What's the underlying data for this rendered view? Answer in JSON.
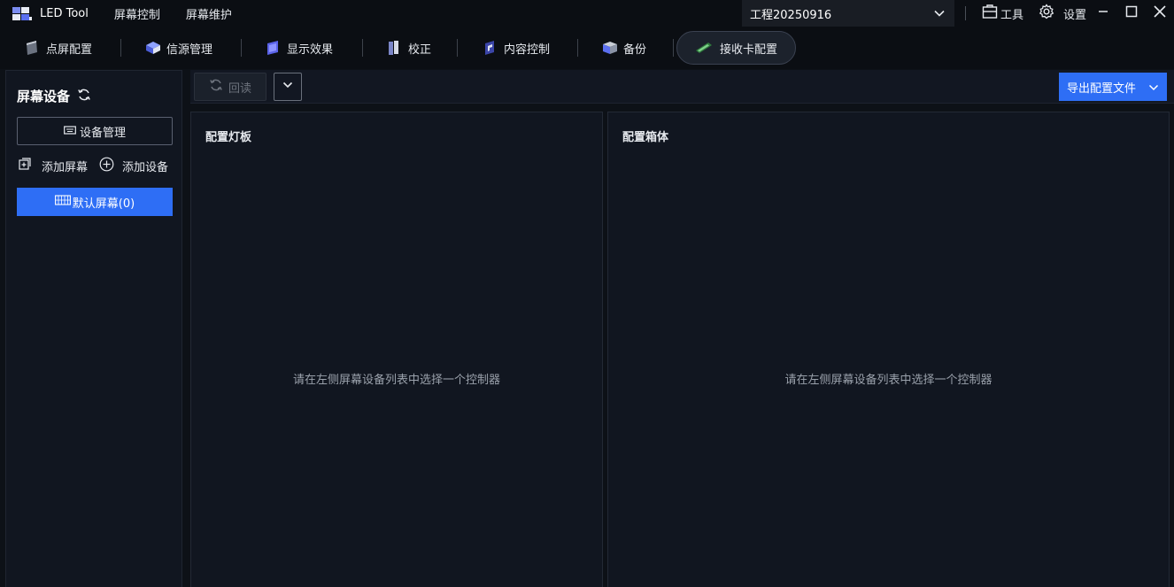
{
  "app": {
    "title": "LED Tool"
  },
  "menu": {
    "items": [
      "屏幕控制",
      "屏幕维护"
    ]
  },
  "project": {
    "name": "工程20250916"
  },
  "titlebar": {
    "tools_label": "工具",
    "settings_label": "设置"
  },
  "tabs": [
    {
      "label": "点屏配置"
    },
    {
      "label": "信源管理"
    },
    {
      "label": "显示效果"
    },
    {
      "label": "校正"
    },
    {
      "label": "内容控制"
    },
    {
      "label": "备份"
    },
    {
      "label": "接收卡配置",
      "active": true
    }
  ],
  "sidebar": {
    "title": "屏幕设备",
    "device_manage_label": "设备管理",
    "add_screen_label": "添加屏幕",
    "add_device_label": "添加设备",
    "screens": [
      {
        "label": "默认屏幕(0)",
        "selected": true
      }
    ]
  },
  "toolbar": {
    "readback_label": "回读",
    "export_label": "导出配置文件"
  },
  "panels": {
    "left": {
      "title": "配置灯板",
      "empty_text": "请在左侧屏幕设备列表中选择一个控制器"
    },
    "right": {
      "title": "配置箱体",
      "empty_text": "请在左侧屏幕设备列表中选择一个控制器"
    }
  },
  "colors": {
    "accent": "#2e6ef5",
    "background": "#0d1117",
    "panel": "#111620"
  }
}
